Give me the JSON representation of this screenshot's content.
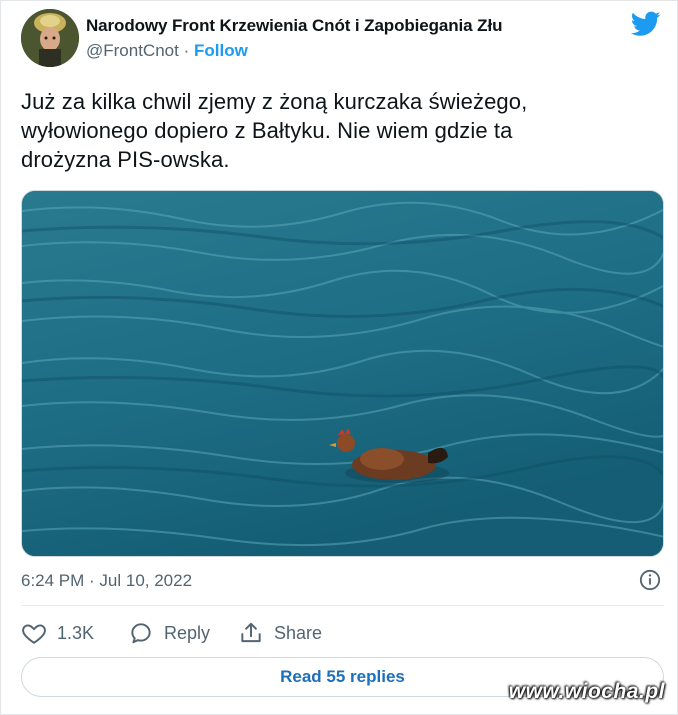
{
  "tweet": {
    "author_name": "Narodowy Front Krzewienia Cnót i Zapobiegania Złu",
    "handle": "@FrontCnot",
    "separator": "·",
    "follow_label": "Follow",
    "text": "Już za kilka chwil zjemy z żoną kurczaka świeżego,\nwyłowionego dopiero z Bałtyku. Nie wiem gdzie ta\ndrożyzna PIS-owska.",
    "timestamp": "6:24 PM · Jul 10, 2022",
    "likes_count": "1.3K",
    "reply_label": "Reply",
    "share_label": "Share",
    "read_replies_label": "Read 55 replies"
  },
  "icons": {
    "brand": "twitter-bird-icon",
    "info": "info-icon",
    "like": "heart-icon",
    "reply": "speech-bubble-icon",
    "share": "share-arrow-icon"
  },
  "colors": {
    "accent": "#1d9bf0",
    "secondary_text": "#536471",
    "sea": "#1f6f86"
  },
  "watermark": "www.wiocha.pl"
}
